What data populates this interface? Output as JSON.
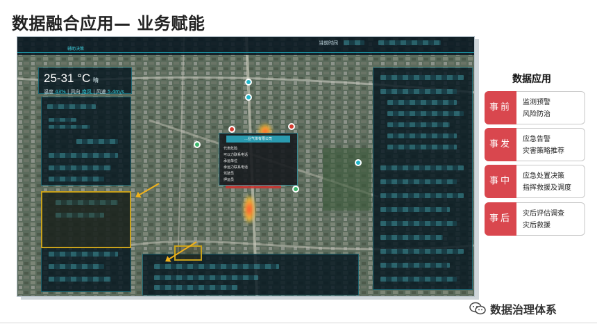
{
  "slide": {
    "title": "数据融合应用— 业务赋能"
  },
  "dashboard": {
    "topbar": {
      "left_title": "辅助决策",
      "current_time_label": "当前时间"
    },
    "weather": {
      "temperature": "25-31 °C",
      "condition": "晴",
      "humidity_label": "温度",
      "humidity_value": "43%",
      "wind_dir_label": "风向",
      "wind_dir_value": "南风",
      "wind_speed_label": "风速",
      "wind_speed_value": "5.4m/s"
    },
    "popup": {
      "header": "...业气体有限公司",
      "rows": [
        "代表危险",
        "可以力联系电话",
        "承运单位",
        "承运力联系电话",
        "驾驶员",
        "押运员"
      ]
    }
  },
  "apps": {
    "title": "数据应用",
    "cards": [
      {
        "tag": "事前",
        "items": [
          "监测预警",
          "风险防治"
        ]
      },
      {
        "tag": "事发",
        "items": [
          "应急告警",
          "灾害策略推荐"
        ]
      },
      {
        "tag": "事中",
        "items": [
          "应急处置决策",
          "指挥救援及调度"
        ]
      },
      {
        "tag": "事后",
        "items": [
          "灾后评估调查",
          "灾后救援"
        ]
      }
    ]
  },
  "watermark": {
    "text": "数据治理体系",
    "icon": "wechat-icon"
  }
}
